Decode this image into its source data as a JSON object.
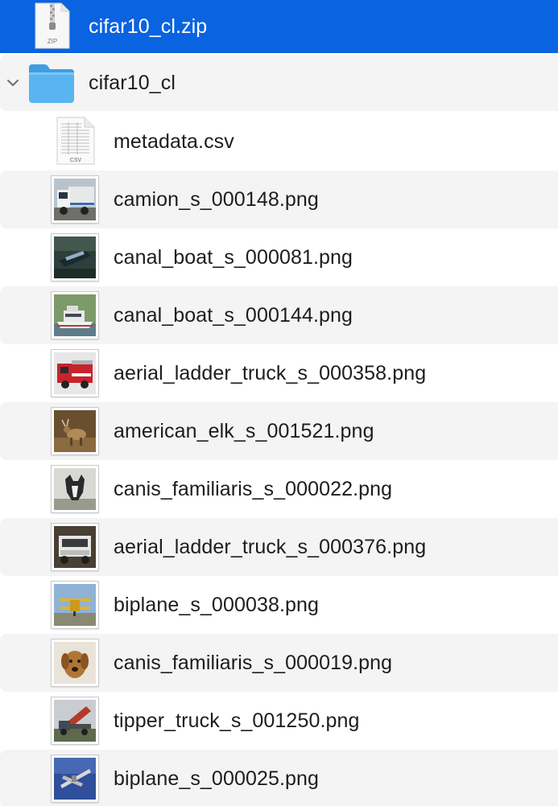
{
  "zip": {
    "name": "cifar10_cl.zip",
    "icon": "zip-archive-icon",
    "badge": "ZIP"
  },
  "folder": {
    "name": "cifar10_cl",
    "icon": "folder-icon",
    "disclosure": "chevron-down-icon"
  },
  "files": [
    {
      "name": "metadata.csv",
      "icon": "csv-file-icon",
      "badge": "CSV"
    },
    {
      "name": "camion_s_000148.png",
      "icon": "truck-thumbnail-icon"
    },
    {
      "name": "canal_boat_s_000081.png",
      "icon": "boat-thumbnail-icon"
    },
    {
      "name": "canal_boat_s_000144.png",
      "icon": "boat-thumbnail-icon"
    },
    {
      "name": "aerial_ladder_truck_s_000358.png",
      "icon": "firetruck-thumbnail-icon"
    },
    {
      "name": "american_elk_s_001521.png",
      "icon": "elk-thumbnail-icon"
    },
    {
      "name": "canis_familiaris_s_000022.png",
      "icon": "dog-thumbnail-icon"
    },
    {
      "name": "aerial_ladder_truck_s_000376.png",
      "icon": "truck-thumbnail-icon"
    },
    {
      "name": "biplane_s_000038.png",
      "icon": "biplane-thumbnail-icon"
    },
    {
      "name": "canis_familiaris_s_000019.png",
      "icon": "dog-thumbnail-icon"
    },
    {
      "name": "tipper_truck_s_001250.png",
      "icon": "tipper-truck-thumbnail-icon"
    },
    {
      "name": "biplane_s_000025.png",
      "icon": "biplane-thumbnail-icon"
    }
  ],
  "colors": {
    "selection": "#0a63e0",
    "alt_row": "#f4f4f5",
    "folder": "#5ab4f0"
  }
}
